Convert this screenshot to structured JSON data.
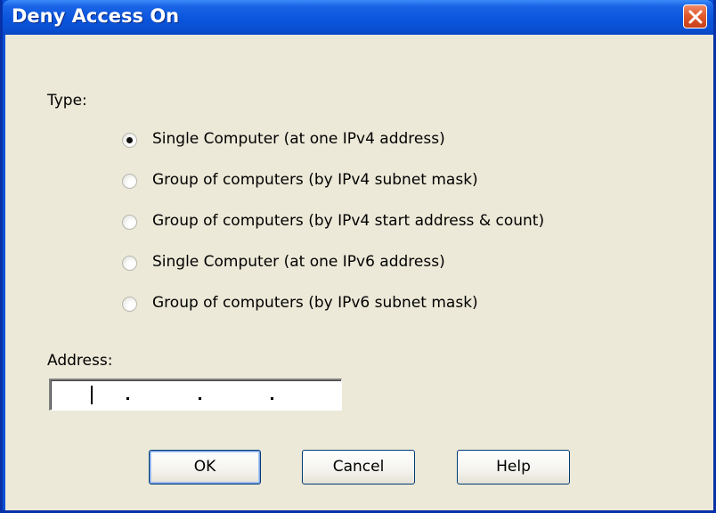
{
  "window": {
    "title": "Deny Access On"
  },
  "type_label": "Type:",
  "options": [
    {
      "label": "Single Computer (at one IPv4 address)",
      "checked": true
    },
    {
      "label": "Group of computers (by IPv4 subnet mask)",
      "checked": false
    },
    {
      "label": "Group of computers (by IPv4 start address & count)",
      "checked": false
    },
    {
      "label": "Single Computer (at one IPv6 address)",
      "checked": false
    },
    {
      "label": "Group of computers (by IPv6 subnet mask)",
      "checked": false
    }
  ],
  "address_label": "Address:",
  "address_value": "",
  "buttons": {
    "ok": "OK",
    "cancel": "Cancel",
    "help": "Help"
  },
  "icons": {
    "close": "close-icon"
  },
  "colors": {
    "titlebar": "#0a55dd",
    "close_button": "#e15a2c",
    "dialog_background": "#ece9d8"
  }
}
